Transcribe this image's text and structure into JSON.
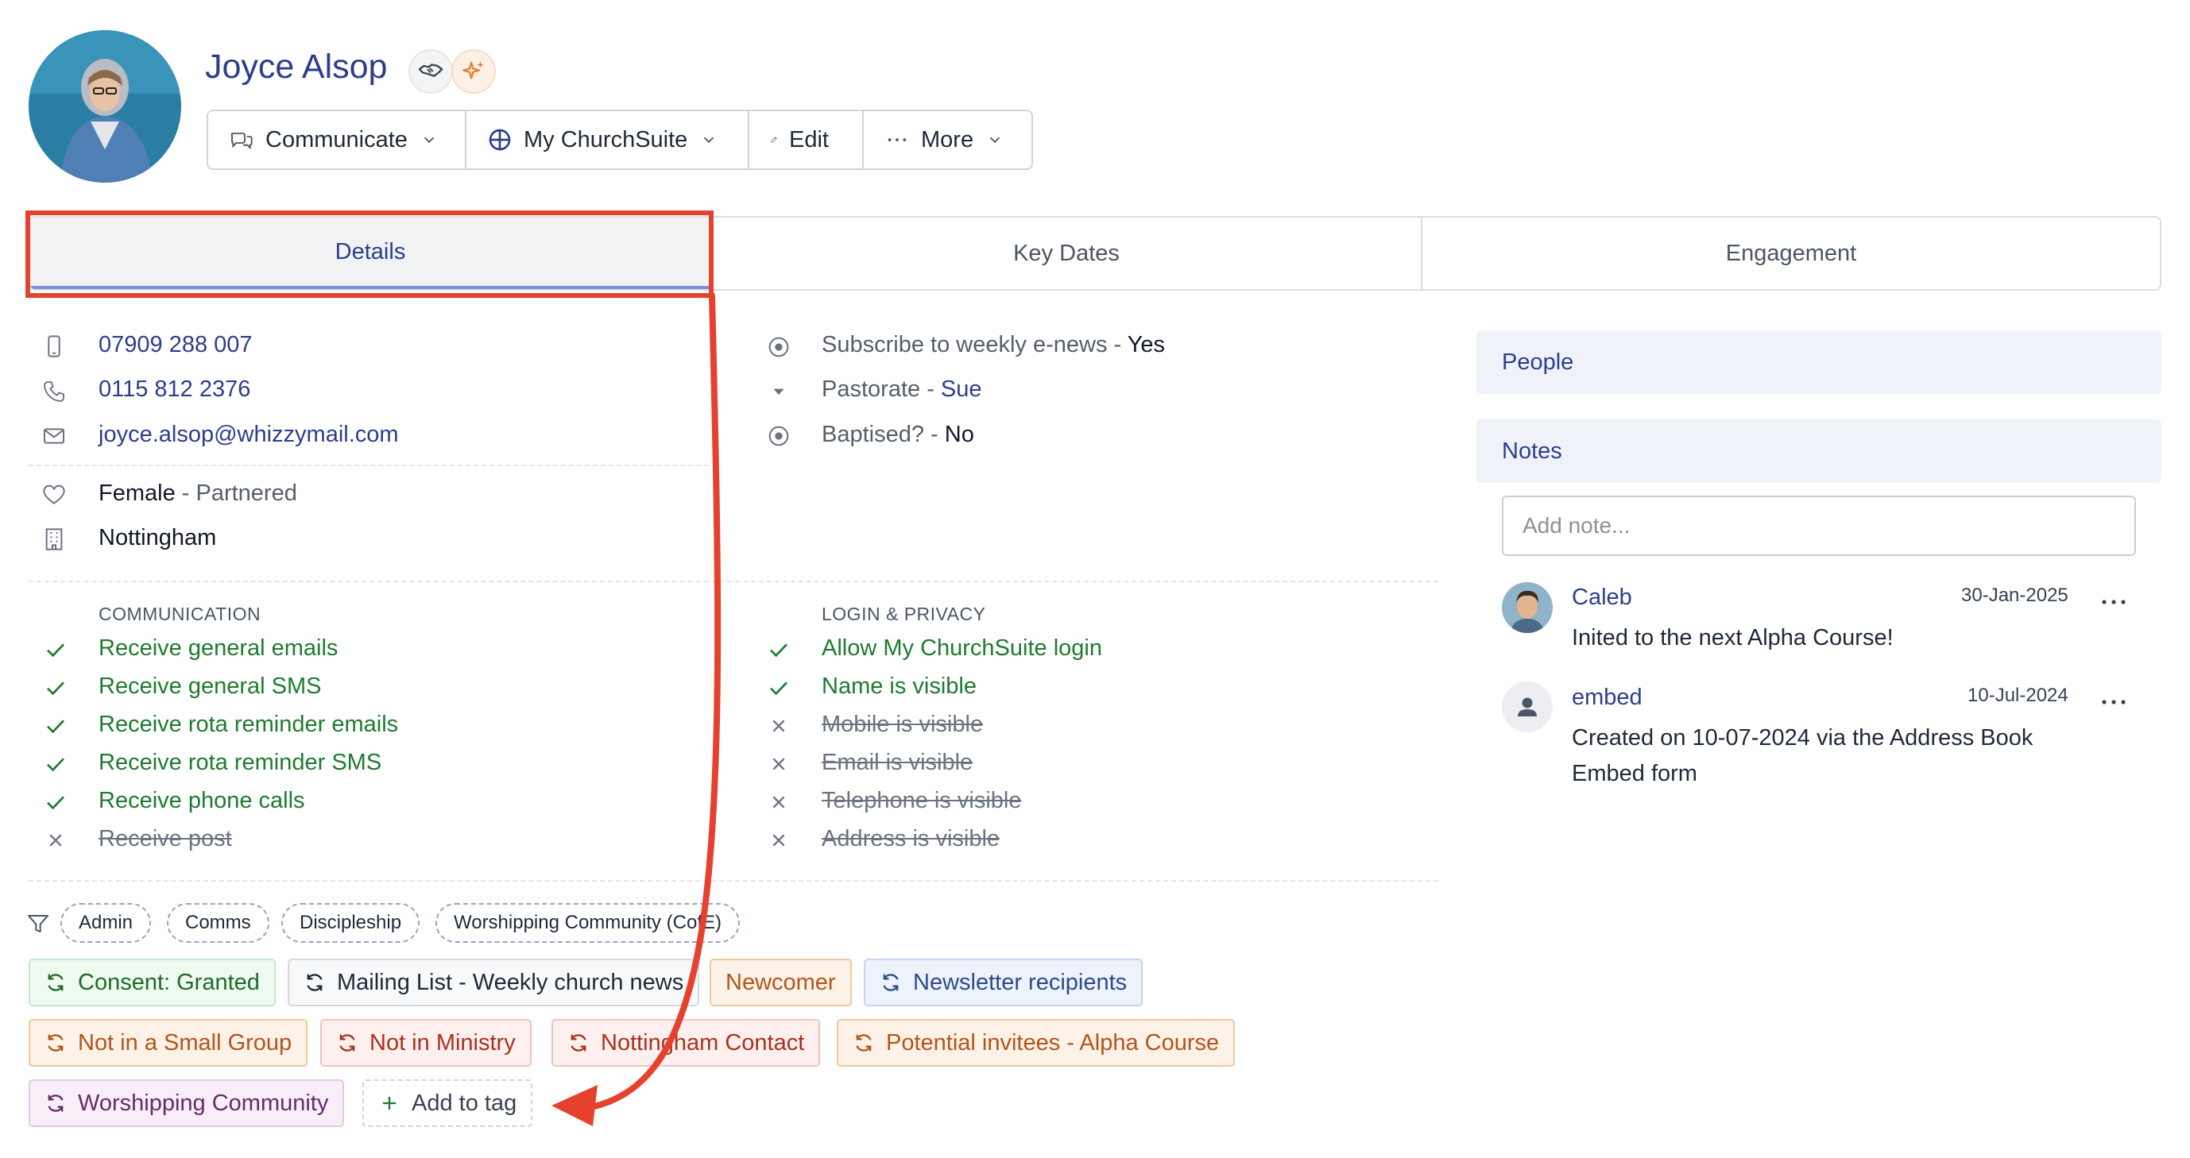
{
  "profile": {
    "name": "Joyce Alsop",
    "icons": [
      "handshake-icon",
      "sparkle-icon"
    ]
  },
  "toolbar": {
    "communicate": "Communicate",
    "mychurchsuite": "My ChurchSuite",
    "edit": "Edit",
    "more": "More"
  },
  "tabs": [
    {
      "label": "Details",
      "active": true
    },
    {
      "label": "Key Dates",
      "active": false
    },
    {
      "label": "Engagement",
      "active": false
    }
  ],
  "contact": {
    "mobile": "07909 288 007",
    "telephone": "0115 812 2376",
    "email": "joyce.alsop@whizzymail.com",
    "sex": "Female",
    "marital_sep": " - ",
    "marital": "Partnered",
    "site": "Nottingham"
  },
  "custom_fields": [
    {
      "label": "Subscribe to weekly e-news",
      "sep": " - ",
      "value": "Yes",
      "icon": "radio-icon"
    },
    {
      "label": "Pastorate",
      "sep": " - ",
      "value": "Sue",
      "icon": "caret-down-icon"
    },
    {
      "label": "Baptised?",
      "sep": " - ",
      "value": "No",
      "icon": "radio-icon"
    }
  ],
  "communication": {
    "heading": "COMMUNICATION",
    "items": [
      {
        "label": "Receive general emails",
        "enabled": true
      },
      {
        "label": "Receive general SMS",
        "enabled": true
      },
      {
        "label": "Receive rota reminder emails",
        "enabled": true
      },
      {
        "label": "Receive rota reminder SMS",
        "enabled": true
      },
      {
        "label": "Receive phone calls",
        "enabled": true
      },
      {
        "label": "Receive post",
        "enabled": false
      }
    ]
  },
  "privacy": {
    "heading": "LOGIN & PRIVACY",
    "items": [
      {
        "label": "Allow My ChurchSuite login",
        "enabled": true
      },
      {
        "label": "Name is visible",
        "enabled": true
      },
      {
        "label": "Mobile is visible",
        "enabled": false
      },
      {
        "label": "Email is visible",
        "enabled": false
      },
      {
        "label": "Telephone is visible",
        "enabled": false
      },
      {
        "label": "Address is visible",
        "enabled": false
      }
    ]
  },
  "filters": [
    "Admin",
    "Comms",
    "Discipleship",
    "Worshipping Community (CofE)"
  ],
  "tags": [
    "Consent: Granted",
    "Mailing List - Weekly church news",
    "Newcomer",
    "Newsletter recipients",
    "Not in a Small Group",
    "Not in Ministry",
    "Nottingham Contact",
    "Potential invitees - Alpha Course",
    "Worshipping Community"
  ],
  "tag_colors": {
    "green": "#1e6b2a",
    "orange": "#b4541a",
    "blue": "#2c4a8c",
    "red": "#a8321f",
    "purple": "#6a2a6a"
  },
  "add_tag": "Add to tag",
  "right_panel": {
    "people": "People",
    "notes": "Notes",
    "note_placeholder": "Add note...",
    "notes_list": [
      {
        "author": "Caleb",
        "date": "30-Jan-2025",
        "text": "Inited to the next Alpha Course!"
      },
      {
        "author": "embed",
        "date": "10-Jul-2024",
        "text_line1": "Created on 10-07-2024 via the Address Book",
        "text_line2": "Embed form"
      }
    ]
  },
  "annotation_color": "#e5412d"
}
